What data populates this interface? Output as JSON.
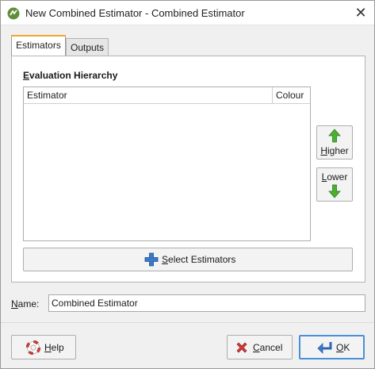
{
  "window": {
    "title": "New Combined Estimator - Combined Estimator",
    "close_glyph": "✕",
    "icon": "leapfrog-app-icon"
  },
  "tabs": [
    {
      "label": "Estimators",
      "active": true
    },
    {
      "label": "Outputs",
      "active": false
    }
  ],
  "estimators_tab": {
    "section_label_mnemonic": "E",
    "section_label_rest": "valuation Hierarchy",
    "table": {
      "columns": [
        "Estimator",
        "Colour"
      ],
      "rows": []
    },
    "higher_button": {
      "mnemonic": "H",
      "rest": "igher",
      "icon": "green-up-arrow-icon"
    },
    "lower_button": {
      "mnemonic": "L",
      "rest": "ower",
      "icon": "green-down-arrow-icon"
    },
    "select_button": {
      "mnemonic": "S",
      "rest": "elect Estimators",
      "icon": "blue-plus-icon"
    }
  },
  "name_field": {
    "label_mnemonic": "N",
    "label_rest": "ame:",
    "value": "Combined Estimator"
  },
  "footer": {
    "help": {
      "mnemonic": "H",
      "rest": "elp",
      "icon": "lifebuoy-icon"
    },
    "cancel": {
      "mnemonic": "C",
      "rest": "ancel",
      "icon": "red-x-icon"
    },
    "ok": {
      "mnemonic": "O",
      "rest": "K",
      "icon": "enter-arrow-icon"
    }
  },
  "colors": {
    "active_tab_accent": "#f2a532",
    "default_button_border": "#4a90d9",
    "arrow_green": "#4caf32",
    "plus_blue": "#3a78c9",
    "cancel_red": "#d23b3b"
  }
}
